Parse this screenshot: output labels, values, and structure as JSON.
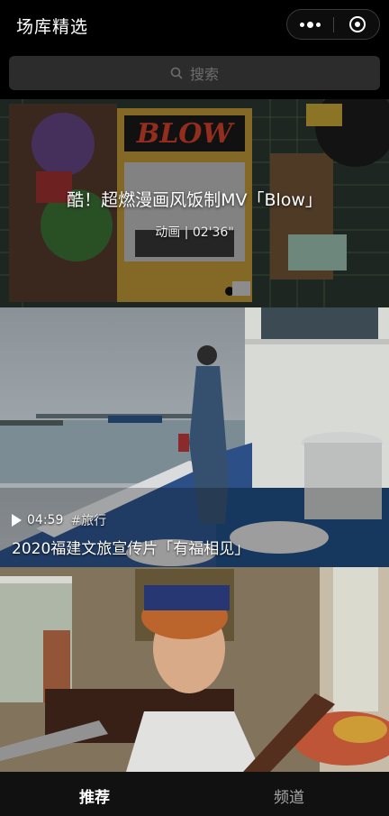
{
  "header": {
    "title": "场库精选"
  },
  "search": {
    "placeholder": "搜索"
  },
  "cards": [
    {
      "title": "酷！超燃漫画风饭制MV「Blow」",
      "meta": "动画 | 02'36\"",
      "cover_word": "BLOW"
    },
    {
      "duration": "04:59",
      "tag": "#旅行",
      "title": "2020福建文旅宣传片「有福相见」"
    },
    {
      "title": ""
    }
  ],
  "tabs": [
    {
      "label": "推荐",
      "active": true
    },
    {
      "label": "频道",
      "active": false
    }
  ],
  "icons": [
    "more-icon",
    "close-circle-icon",
    "search-icon",
    "play-icon"
  ]
}
